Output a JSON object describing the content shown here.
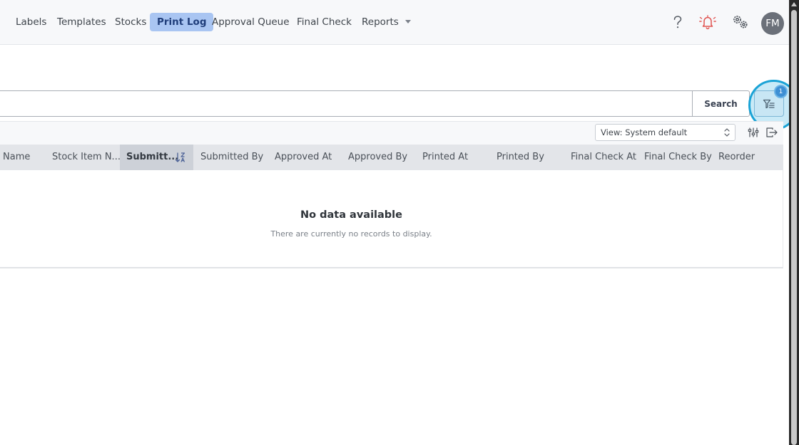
{
  "nav": {
    "items": [
      {
        "label": "Labels",
        "active": false
      },
      {
        "label": "Templates",
        "active": false
      },
      {
        "label": "Stocks",
        "active": false
      },
      {
        "label": "Print Log",
        "active": true
      },
      {
        "label": "Approval Queue",
        "active": false
      },
      {
        "label": "Final Check",
        "active": false
      },
      {
        "label": "Reports",
        "active": false,
        "dropdown": true
      }
    ],
    "icons": [
      "help-icon",
      "alarm-bell-icon",
      "settings-gears-icon"
    ],
    "avatar_initials": "FM"
  },
  "search": {
    "placeholder": "",
    "value": "",
    "button_label": "Search"
  },
  "filter": {
    "icon": "filter-icon",
    "badge_count": "1"
  },
  "toolbar": {
    "view_select": "View: System default",
    "icons": [
      "column-settings-icon",
      "export-icon"
    ]
  },
  "table": {
    "columns": [
      {
        "label": "Name",
        "sorted": false
      },
      {
        "label": "Stock Item N...",
        "sorted": false
      },
      {
        "label": "Submitt...",
        "sorted": true,
        "sort_direction": "ascending"
      },
      {
        "label": "Submitted By",
        "sorted": false
      },
      {
        "label": "Approved At",
        "sorted": false
      },
      {
        "label": "Approved By",
        "sorted": false
      },
      {
        "label": "Printed At",
        "sorted": false
      },
      {
        "label": "Printed By",
        "sorted": false
      },
      {
        "label": "Final Check At",
        "sorted": false
      },
      {
        "label": "Final Check By",
        "sorted": false
      },
      {
        "label": "Reorder",
        "sorted": false
      }
    ],
    "rows": [],
    "empty_title": "No data available",
    "empty_subtitle": "There are currently no records to display."
  },
  "colors": {
    "active_nav_bg": "#a9c5f2",
    "alarm_icon": "#e0524f",
    "highlight_ring": "#1aa3d6",
    "badge": "#3d8fd4"
  }
}
